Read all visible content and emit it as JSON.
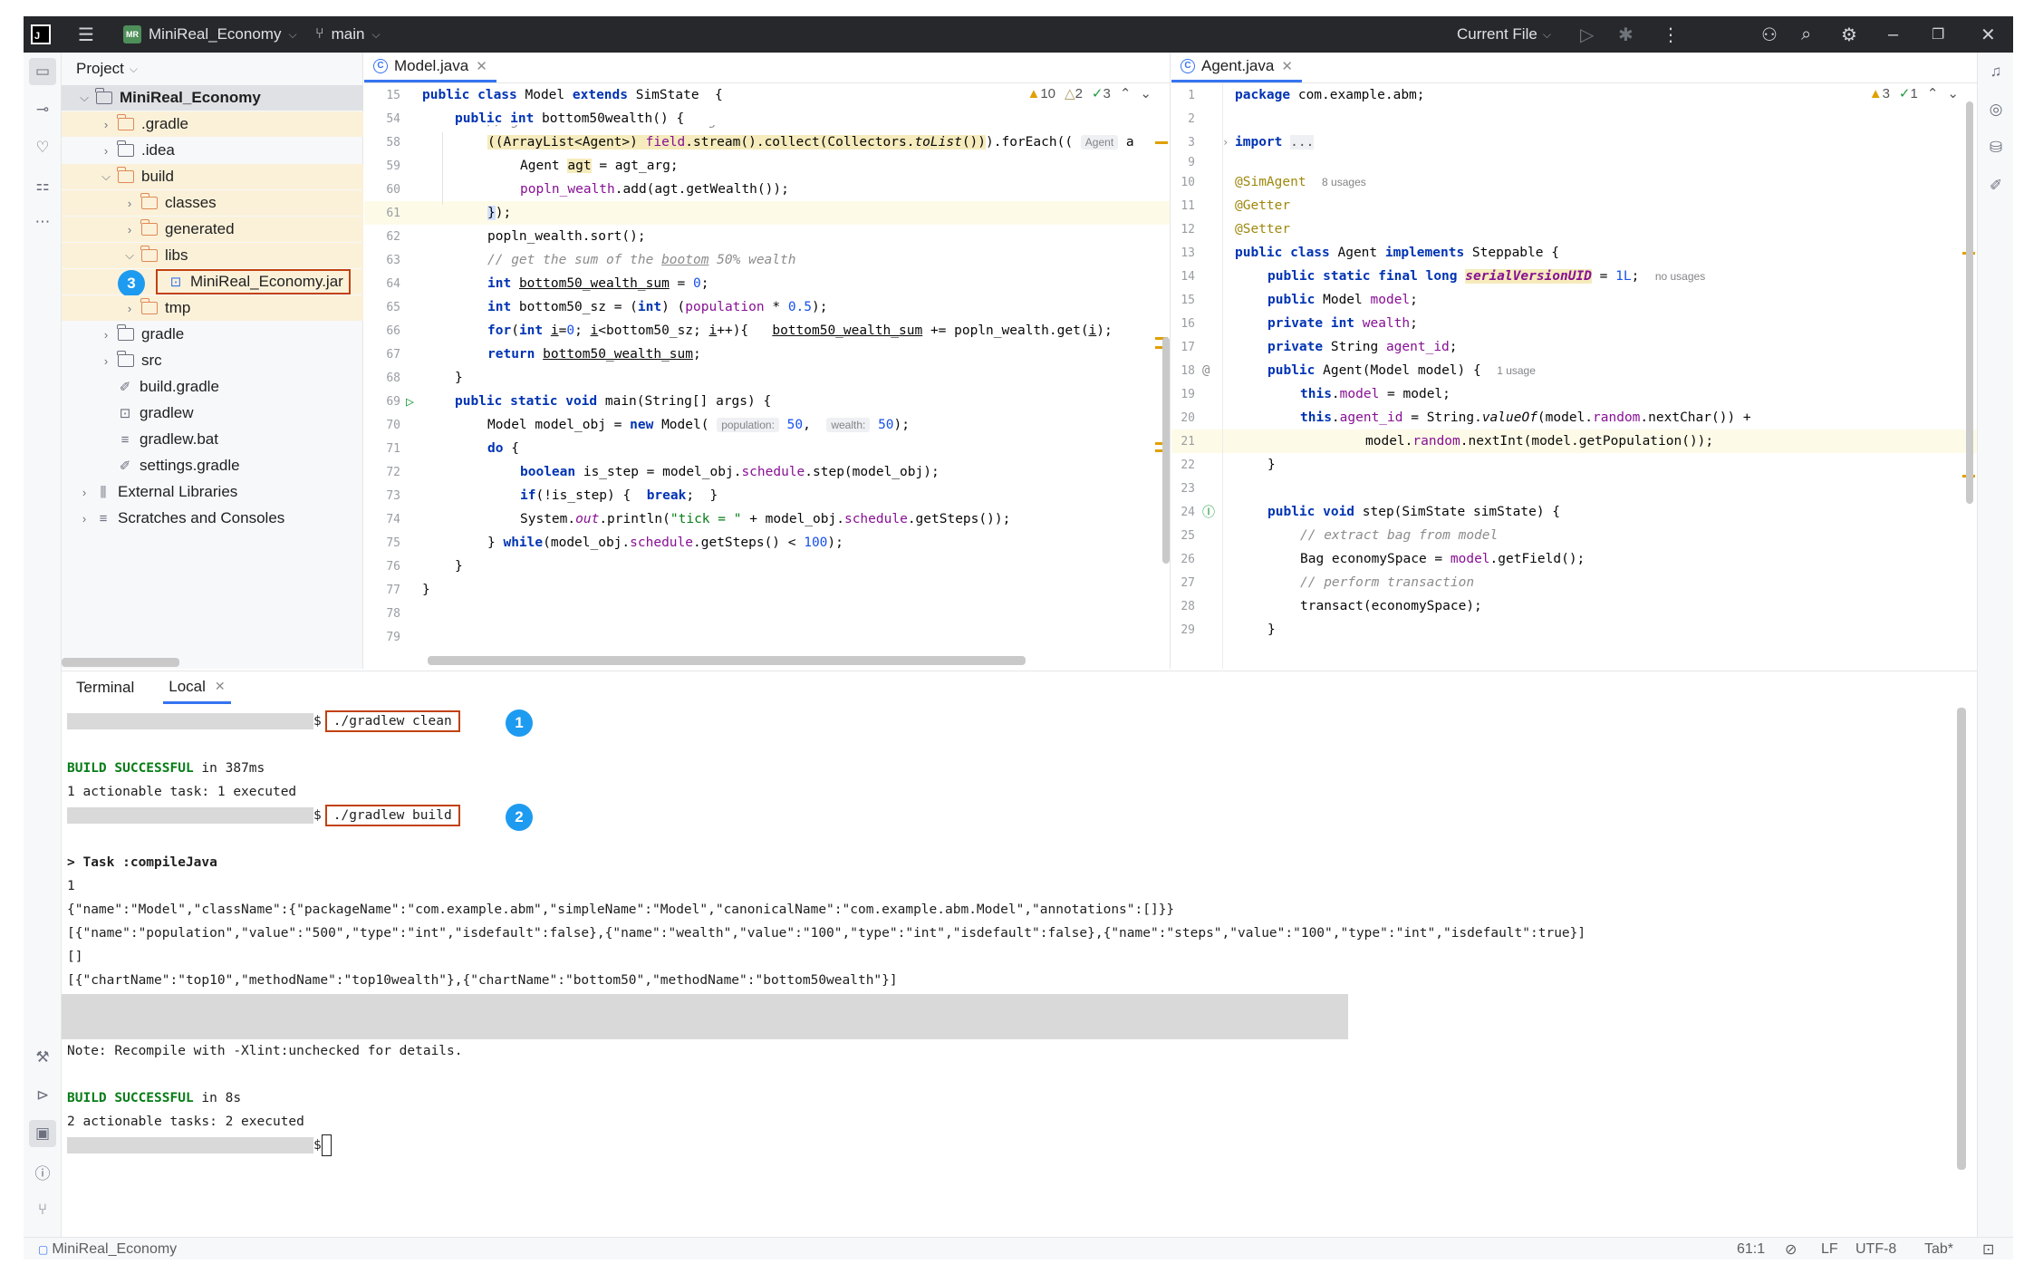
{
  "titlebar": {
    "project_name": "MiniReal_Economy",
    "project_badge": "MR",
    "branch": "main",
    "run_config": "Current File"
  },
  "project_panel": {
    "title": "Project",
    "tree": [
      {
        "label": "MiniReal_Economy"
      },
      {
        "label": ".gradle"
      },
      {
        "label": ".idea"
      },
      {
        "label": "build"
      },
      {
        "label": "classes"
      },
      {
        "label": "generated"
      },
      {
        "label": "libs"
      },
      {
        "label": "MiniReal_Economy.jar"
      },
      {
        "label": "tmp"
      },
      {
        "label": "gradle"
      },
      {
        "label": "src"
      },
      {
        "label": "build.gradle"
      },
      {
        "label": "gradlew"
      },
      {
        "label": "gradlew.bat"
      },
      {
        "label": "settings.gradle"
      },
      {
        "label": "External Libraries"
      },
      {
        "label": "Scratches and Consoles"
      }
    ],
    "marker": "3"
  },
  "editor_left": {
    "tab": "Model.java",
    "inspections": {
      "warnings": "10",
      "weak_warnings": "2",
      "ok": "3"
    },
    "line_numbers": [
      "15",
      "54",
      "",
      "58",
      "59",
      "60",
      "61",
      "62",
      "63",
      "64",
      "65",
      "66",
      "67",
      "68",
      "69",
      "70",
      "71",
      "72",
      "73",
      "74",
      "75",
      "76",
      "77",
      "78",
      "79"
    ]
  },
  "editor_right": {
    "tab": "Agent.java",
    "inspections": {
      "warnings": "3",
      "ok": "1"
    },
    "line_numbers": [
      "1",
      "2",
      "3",
      "9",
      "10",
      "11",
      "12",
      "13",
      "14",
      "15",
      "16",
      "17",
      "18",
      "19",
      "20",
      "21",
      "22",
      "23",
      "24",
      "25",
      "26",
      "27",
      "28",
      "29"
    ]
  },
  "terminal": {
    "tab_terminal": "Terminal",
    "tab_local": "Local",
    "cmd1": "./gradlew clean",
    "marker1": "1",
    "build1_status": "BUILD SUCCESSFUL",
    "build1_time": " in 387ms",
    "build1_tasks": "1 actionable task: 1 executed",
    "cmd2": "./gradlew build",
    "marker2": "2",
    "task_line": "> Task :compileJava",
    "out_1": "1",
    "out_json1": "{\"name\":\"Model\",\"className\":{\"packageName\":\"com.example.abm\",\"simpleName\":\"Model\",\"canonicalName\":\"com.example.abm.Model\",\"annotations\":[]}}",
    "out_json2": "[{\"name\":\"population\",\"value\":\"500\",\"type\":\"int\",\"isdefault\":false},{\"name\":\"wealth\",\"value\":\"100\",\"type\":\"int\",\"isdefault\":false},{\"name\":\"steps\",\"value\":\"100\",\"type\":\"int\",\"isdefault\":true}]",
    "out_empty": "[]",
    "out_json3": "[{\"chartName\":\"top10\",\"methodName\":\"top10wealth\"},{\"chartName\":\"bottom50\",\"methodName\":\"bottom50wealth\"}]",
    "note": "Note: Recompile with -Xlint:unchecked for details.",
    "build2_status": "BUILD SUCCESSFUL",
    "build2_time": " in 8s",
    "build2_tasks": "2 actionable tasks: 2 executed",
    "prompt": "$"
  },
  "statusbar": {
    "project": "MiniReal_Economy",
    "position": "61:1",
    "line_sep": "LF",
    "encoding": "UTF-8",
    "indent": "Tab*"
  }
}
